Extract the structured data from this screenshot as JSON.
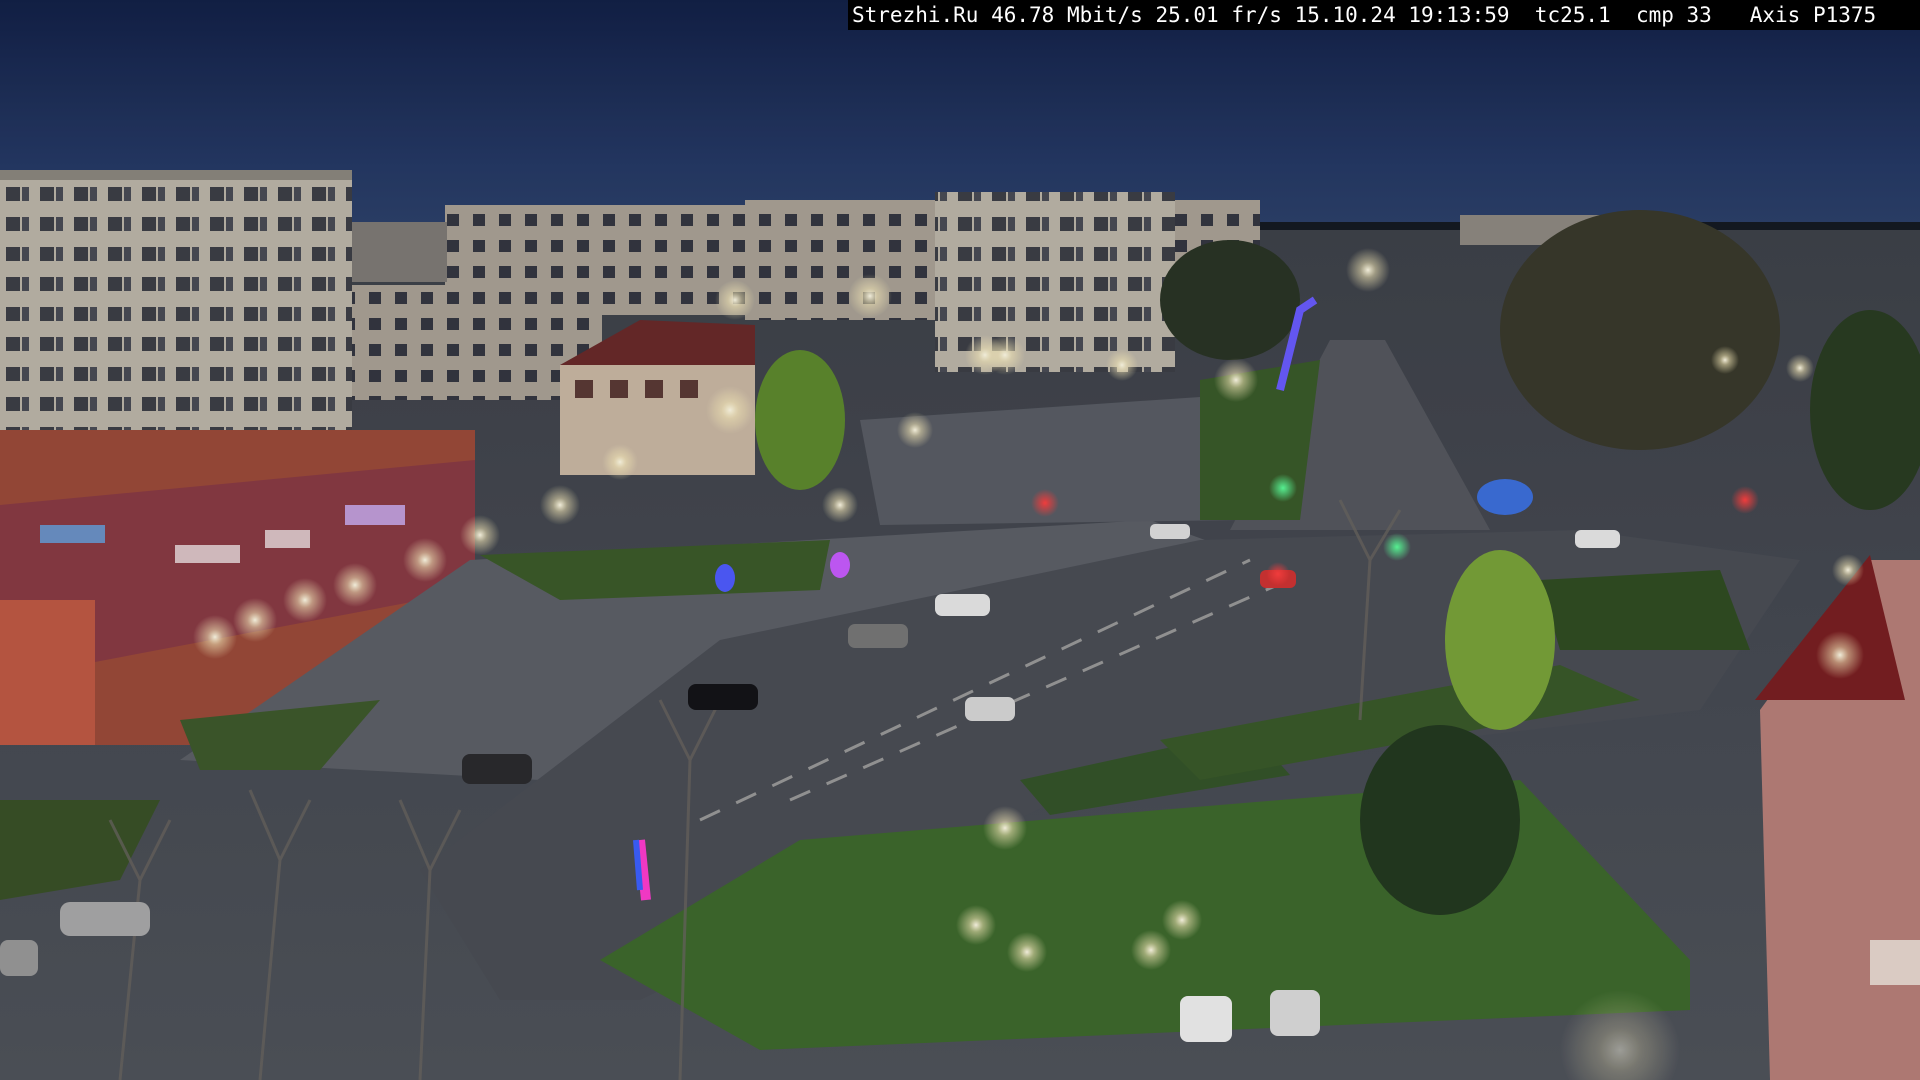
{
  "camera_overlay": {
    "site": "Strezhi.Ru",
    "bitrate": "46.78 Mbit/s",
    "framerate": "25.01 fr/s",
    "datetime": "15.10.24 19:13:59",
    "timecode": "tc25.1",
    "compression": "cmp 33",
    "camera_model": "Axis P1375"
  },
  "scene": {
    "colors": {
      "sky_top": "#14234a",
      "sky_bottom": "#2a3f6a",
      "road": "#4a4e57",
      "grass": "#3a5a2a",
      "building_light": "#b9b2a6",
      "shop_facade": "#a4483a",
      "window_lit": "#f3d98a",
      "street_light": "#fff8e0"
    }
  }
}
